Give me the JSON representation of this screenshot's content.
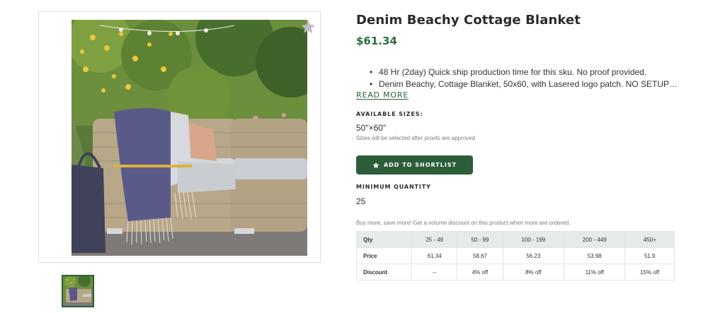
{
  "product": {
    "title": "Denim Beachy Cottage Blanket",
    "price": "$61.34",
    "bullets": [
      "48 Hr (2day) Quick ship production time for this sku. No proof provided.",
      "Denim Beachy, Cottage Blanket, 50x60, with Lasered logo patch. NO SETUP…"
    ],
    "read_more": "READ MORE"
  },
  "sizes": {
    "label": "AVAILABLE SIZES:",
    "value": "50\"×60\"",
    "note": "Sizes will be selected after proofs are approved"
  },
  "shortlist": {
    "label": "ADD TO SHORTLIST",
    "icon": "star-icon"
  },
  "minimum_quantity": {
    "label": "MINIMUM QUANTITY",
    "value": "25"
  },
  "volume": {
    "note": "Buy more, save more! Get a volume discount on this product when more are ordered.",
    "headers": [
      "Qty",
      "25 - 49",
      "50 - 99",
      "100 - 199",
      "200 - 449",
      "450+"
    ],
    "rows": [
      [
        "Price",
        "61.34",
        "58.67",
        "56.23",
        "53.98",
        "51.9"
      ],
      [
        "Discount",
        "--",
        "4% off",
        "8% off",
        "11% off",
        "15% off"
      ]
    ]
  },
  "gallery": {
    "favorite_icon": "star-outline-icon"
  },
  "colors": {
    "brand_green": "#2c5e3a",
    "price_green": "#2c6e3e",
    "table_header_bg": "#e6ebe8"
  }
}
